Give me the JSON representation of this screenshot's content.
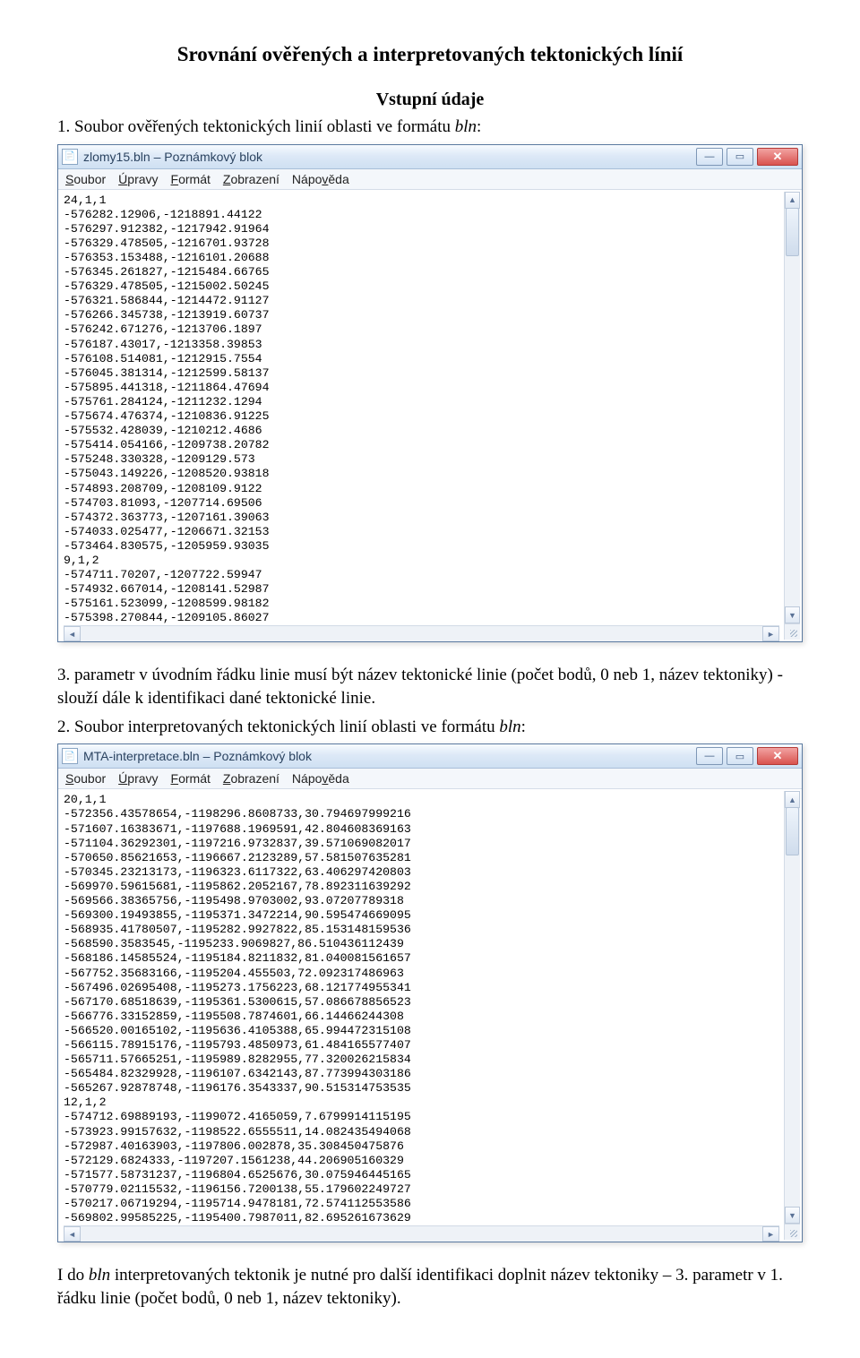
{
  "heading": "Srovnání ověřených a interpretovaných tektonických línií",
  "sub": "Vstupní údaje",
  "p1a": "1. Soubor ověřených tektonických linií oblasti ve formátu ",
  "p1b": "bln",
  "p1c": ":",
  "p2": "3. parametr v úvodním řádku linie musí být název tektonické linie (počet bodů, 0 neb 1, název tektoniky) - slouží dále k identifikaci dané tektonické linie.",
  "p3a": "2. Soubor interpretovaných tektonických linií oblasti ve formátu ",
  "p3b": "bln",
  "p3c": ":",
  "p4a": "I do ",
  "p4b": "bln",
  "p4c": " interpretovaných tektonik je nutné pro další identifikaci doplnit název tektoniky – 3. parametr v 1. řádku linie (počet bodů, 0 neb 1, název tektoniky).",
  "win1": {
    "title": "zlomy15.bln – Poznámkový blok",
    "menu": {
      "m0": "S",
      "m0r": "oubor",
      "m1": "Ú",
      "m1r": "pravy",
      "m2": "F",
      "m2r": "ormát",
      "m3": "Z",
      "m3r": "obrazení",
      "m4": "Nápo",
      "m4u": "v",
      "m4r": "ěda"
    },
    "text": "24,1,1\n-576282.12906,-1218891.44122\n-576297.912382,-1217942.91964\n-576329.478505,-1216701.93728\n-576353.153488,-1216101.20688\n-576345.261827,-1215484.66765\n-576329.478505,-1215002.50245\n-576321.586844,-1214472.91127\n-576266.345738,-1213919.60737\n-576242.671276,-1213706.1897\n-576187.43017,-1213358.39853\n-576108.514081,-1212915.7554\n-576045.381314,-1212599.58137\n-575895.441318,-1211864.47694\n-575761.284124,-1211232.1294\n-575674.476374,-1210836.91225\n-575532.428039,-1210212.4686\n-575414.054166,-1209738.20782\n-575248.330328,-1209129.573\n-575043.149226,-1208520.93818\n-574893.208709,-1208109.9122\n-574703.81093,-1207714.69506\n-574372.363773,-1207161.39063\n-574033.025477,-1206671.32153\n-573464.830575,-1205959.93035\n9,1,2\n-574711.70207,-1207722.59947\n-574932.667014,-1208141.52987\n-575161.523099,-1208599.98182\n-575398.270844,-1209105.86027"
  },
  "win2": {
    "title": "MTA-interpretace.bln – Poznámkový blok",
    "text": "20,1,1\n-572356.43578654,-1198296.8608733,30.794697999216\n-571607.16383671,-1197688.1969591,42.804608369163\n-571104.36292301,-1197216.9732837,39.571069082017\n-570650.85621653,-1196667.2123289,57.581507635281\n-570345.23213173,-1196323.6117322,63.406297420803\n-569970.59615681,-1195862.2052167,78.892311639292\n-569566.38365756,-1195498.9703002,93.07207789318\n-569300.19493855,-1195371.3472214,90.595474669095\n-568935.41780507,-1195282.9927822,85.153148159536\n-568590.3583545,-1195233.9069827,86.510436112439\n-568186.14585524,-1195184.8211832,81.040081561657\n-567752.35683166,-1195204.455503,72.092317486963\n-567496.02695408,-1195273.1756223,68.121774955341\n-567170.68518639,-1195361.5300615,57.086678856523\n-566776.33152859,-1195508.7874601,66.14466244308\n-566520.00165102,-1195636.4105388,65.994472315108\n-566115.78915176,-1195793.4850973,61.484165577407\n-565711.57665251,-1195989.8282955,77.320026215834\n-565484.82329928,-1196107.6342143,87.773994303186\n-565267.92878748,-1196176.3543337,90.515314753535\n12,1,2\n-574712.69889193,-1199072.4165059,7.6799914115195\n-573923.99157632,-1198522.6555511,14.082435494068\n-572987.40163903,-1197806.002878,35.308450475876\n-572129.6824333,-1197207.1561238,44.206905160329\n-571577.58731237,-1196804.6525676,30.075946445165\n-570779.02115532,-1196156.7200138,55.179602249727\n-570217.06719294,-1195714.9478181,72.574112553586\n-569802.99585225,-1195400.7987011,82.695261673629"
  },
  "btns": {
    "min": "—",
    "max": "▭",
    "close": "✕",
    "up": "▲",
    "down": "▼",
    "left": "◄",
    "right": "►"
  }
}
